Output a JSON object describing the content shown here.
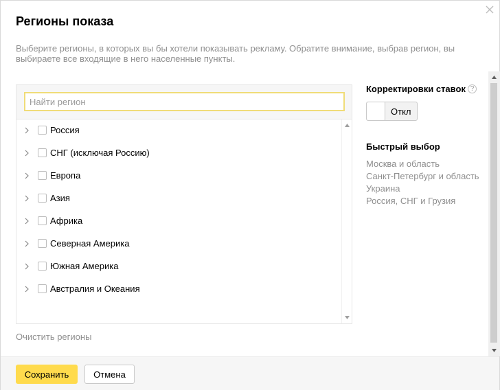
{
  "dialog": {
    "title": "Регионы показа",
    "description": "Выберите регионы, в которых вы бы хотели показывать рекламу. Обратите внимание, выбрав регион, вы выбираете все входящие в него населенные пункты.",
    "close_icon": "close-icon"
  },
  "search": {
    "placeholder": "Найти регион",
    "value": ""
  },
  "regions": [
    {
      "label": "Россия",
      "checked": false,
      "expandable": true
    },
    {
      "label": "СНГ (исключая Россию)",
      "checked": false,
      "expandable": true
    },
    {
      "label": "Европа",
      "checked": false,
      "expandable": true
    },
    {
      "label": "Азия",
      "checked": false,
      "expandable": true
    },
    {
      "label": "Африка",
      "checked": false,
      "expandable": true
    },
    {
      "label": "Северная Америка",
      "checked": false,
      "expandable": true
    },
    {
      "label": "Южная Америка",
      "checked": false,
      "expandable": true
    },
    {
      "label": "Австралия и Океания",
      "checked": false,
      "expandable": true
    }
  ],
  "clear_label": "Очистить регионы",
  "bid_adjustments": {
    "title": "Корректировки ставок",
    "help_icon": "question-icon",
    "help_symbol": "?",
    "toggle_label": "Откл",
    "toggle_on": false
  },
  "quick_select": {
    "title": "Быстрый выбор",
    "items": [
      "Москва и область",
      "Санкт-Петербург и область",
      "Украина",
      "Россия, СНГ и Грузия"
    ]
  },
  "footer": {
    "save_label": "Сохранить",
    "cancel_label": "Отмена"
  },
  "colors": {
    "accent": "#ffdb4d",
    "search_border": "#f0dc78",
    "muted_text": "#8f8f8f"
  }
}
